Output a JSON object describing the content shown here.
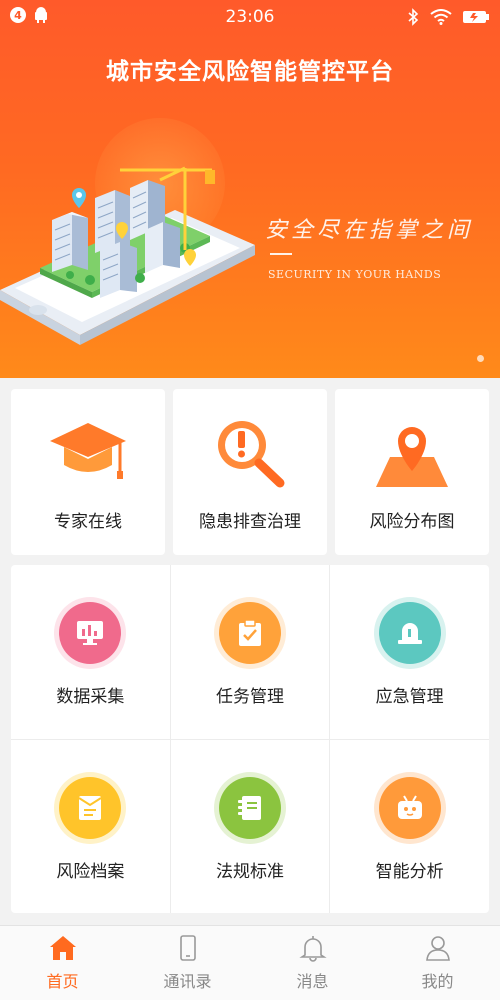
{
  "status_bar": {
    "notification_count": "4",
    "time": "23:06"
  },
  "app": {
    "title": "城市安全风险智能管控平台"
  },
  "banner": {
    "slogan": "安全尽在指掌之间",
    "slogan_sub": "SECURITY IN YOUR HANDS"
  },
  "features": [
    {
      "label": "专家在线",
      "icon": "graduation-cap-icon"
    },
    {
      "label": "隐患排查治理",
      "icon": "magnifier-alert-icon"
    },
    {
      "label": "风险分布图",
      "icon": "map-pin-icon"
    }
  ],
  "grid": [
    {
      "label": "数据采集",
      "icon": "data-monitor-icon",
      "color": "#f06a8c"
    },
    {
      "label": "任务管理",
      "icon": "clipboard-check-icon",
      "color": "#ffa23a"
    },
    {
      "label": "应急管理",
      "icon": "emergency-beacon-icon",
      "color": "#5cc8c0"
    },
    {
      "label": "风险档案",
      "icon": "archive-envelope-icon",
      "color": "#ffc42a"
    },
    {
      "label": "法规标准",
      "icon": "rulebook-icon",
      "color": "#8bc43f"
    },
    {
      "label": "智能分析",
      "icon": "robot-tv-icon",
      "color": "#ff9a3a"
    }
  ],
  "tabs": [
    {
      "label": "首页",
      "icon": "home-icon",
      "active": true
    },
    {
      "label": "通讯录",
      "icon": "phone-icon",
      "active": false
    },
    {
      "label": "消息",
      "icon": "bell-icon",
      "active": false
    },
    {
      "label": "我的",
      "icon": "user-icon",
      "active": false
    }
  ],
  "colors": {
    "accent": "#ff6a1f",
    "banner_top": "#ff5a2a",
    "banner_bottom": "#ff8a1a"
  }
}
